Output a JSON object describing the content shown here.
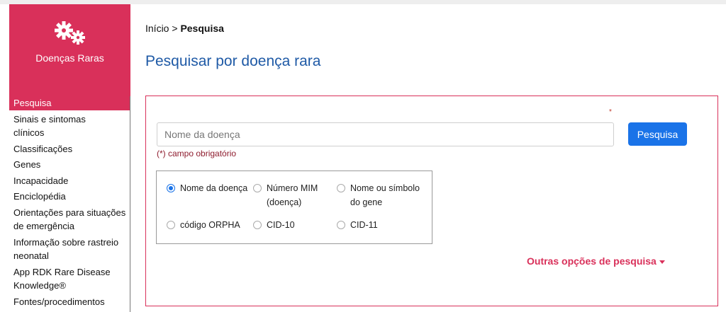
{
  "logo": {
    "text": "Doenças Raras",
    "color": "#d9305a"
  },
  "sidebar": {
    "items": [
      {
        "label": "Pesquisa",
        "active": true
      },
      {
        "label": "Sinais e sintomas clínicos"
      },
      {
        "label": "Classificações"
      },
      {
        "label": "Genes"
      },
      {
        "label": "Incapacidade"
      },
      {
        "label": "Enciclopédia"
      },
      {
        "label": "Orientações para situações de emergência"
      },
      {
        "label": "Informação sobre rastreio neonatal"
      },
      {
        "label": "App RDK Rare Disease Knowledge®"
      },
      {
        "label": "Fontes/procedimentos"
      }
    ]
  },
  "breadcrumb": {
    "home": "Início",
    "separator": ">",
    "current": "Pesquisa"
  },
  "page_title": "Pesquisar por doença rara",
  "search": {
    "required_mark": "*",
    "placeholder": "Nome da doença",
    "value": "",
    "button_label": "Pesquisa",
    "required_note": "(*) campo obrigatório",
    "button_color": "#1a73e8"
  },
  "search_options": [
    {
      "label": "Nome da doença",
      "checked": true
    },
    {
      "label": "Número MIM (doença)"
    },
    {
      "label": "Nome ou símbolo do gene"
    },
    {
      "label": "código ORPHA"
    },
    {
      "label": "CID-10"
    },
    {
      "label": "CID-11"
    }
  ],
  "more_options_label": "Outras opções de pesquisa"
}
